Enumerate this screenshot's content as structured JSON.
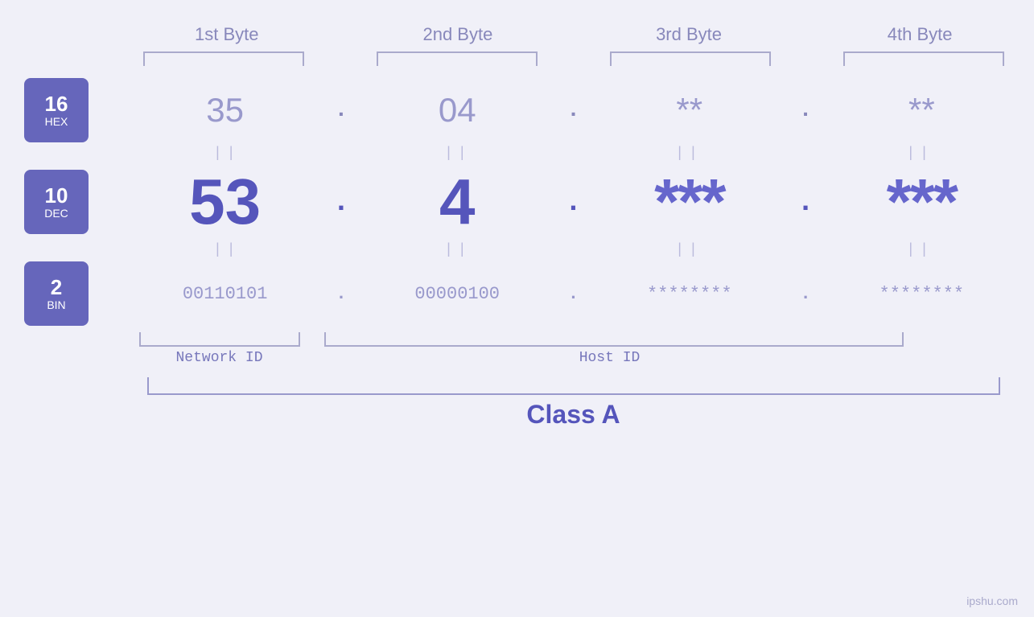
{
  "headers": {
    "byte1": "1st Byte",
    "byte2": "2nd Byte",
    "byte3": "3rd Byte",
    "byte4": "4th Byte"
  },
  "badges": {
    "hex": {
      "number": "16",
      "label": "HEX"
    },
    "dec": {
      "number": "10",
      "label": "DEC"
    },
    "bin": {
      "number": "2",
      "label": "BIN"
    }
  },
  "values": {
    "hex": {
      "b1": "35",
      "b2": "04",
      "b3": "**",
      "b4": "**",
      "d1": ".",
      "d2": ".",
      "d3": ".",
      "d4": "."
    },
    "dec": {
      "b1": "53",
      "b2": "4",
      "b3": "***",
      "b4": "***",
      "d1": ".",
      "d2": ".",
      "d3": ".",
      "d4": "."
    },
    "bin": {
      "b1": "00110101",
      "b2": "00000100",
      "b3": "********",
      "b4": "********",
      "d1": ".",
      "d2": ".",
      "d3": ".",
      "d4": "."
    }
  },
  "labels": {
    "network_id": "Network ID",
    "host_id": "Host ID",
    "class": "Class A"
  },
  "watermark": "ipshu.com",
  "equals": "||"
}
